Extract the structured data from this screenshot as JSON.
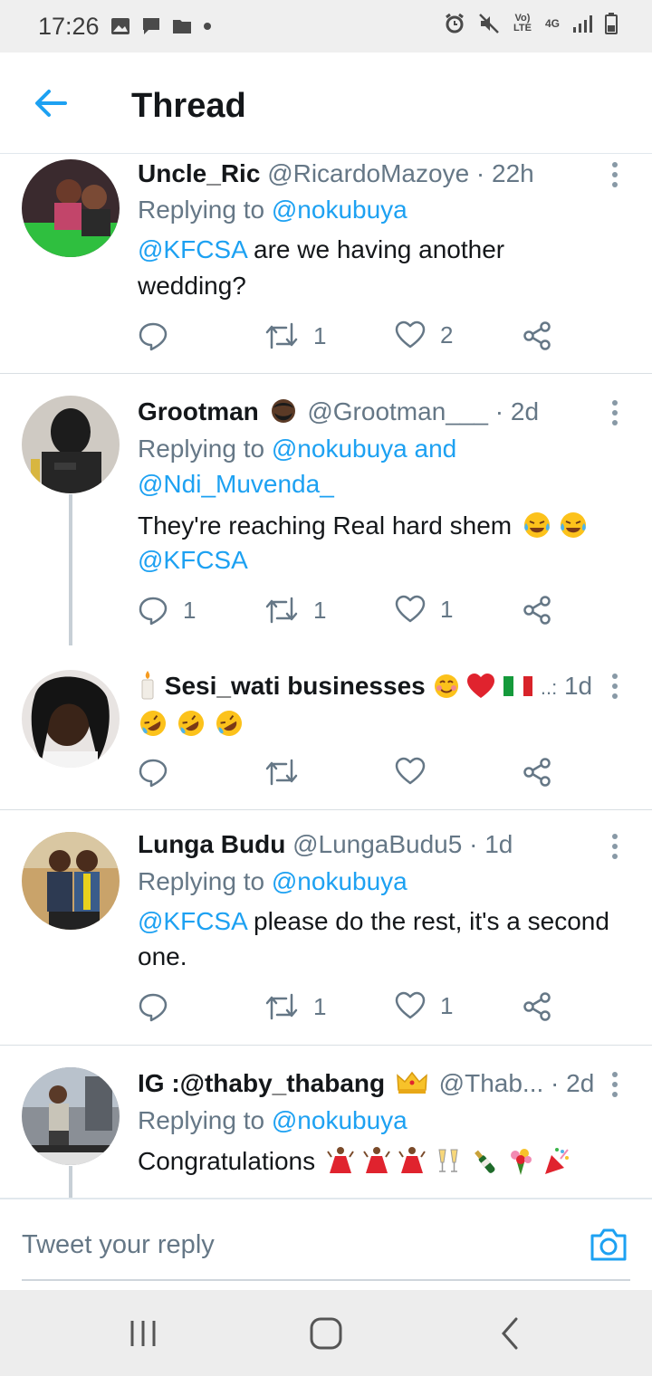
{
  "status_bar": {
    "time": "17:26",
    "volte_label": "Vo) LTE",
    "network": "4G"
  },
  "header": {
    "title": "Thread"
  },
  "tweets": [
    {
      "name": "Uncle_Ric",
      "handle": "@RicardoMazoye",
      "time": "· 22h",
      "replying_prefix": "Replying to ",
      "replying_to": "@nokubuya",
      "text_line1_mention": "@KFCSA",
      "text_line1_rest": " are we having another",
      "text_line2": "wedding?",
      "reply_count": "",
      "retweet_count": "1",
      "like_count": "2"
    },
    {
      "name": "Grootman",
      "handle": "@Grootman___",
      "time": "· 2d",
      "replying_prefix": "Replying to ",
      "replying_to": "@nokubuya and",
      "replying_to_2": "@Ndi_Muvenda_",
      "text_line1": "They're reaching Real hard shem",
      "text_line2": "@KFCSA",
      "reply_count": "1",
      "retweet_count": "1",
      "like_count": "1"
    },
    {
      "name": "Sesi_wati businesses",
      "time": "1d",
      "reply_count": "",
      "retweet_count": "",
      "like_count": ""
    },
    {
      "name": "Lunga Budu",
      "handle": "@LungaBudu5",
      "time": "· 1d",
      "replying_prefix": "Replying to ",
      "replying_to": "@nokubuya",
      "text_line1_mention": "@KFCSA",
      "text_line1_rest": " please do the rest, it's a second",
      "text_line2": "one.",
      "reply_count": "",
      "retweet_count": "1",
      "like_count": "1"
    },
    {
      "name": "IG :@thaby_thabang",
      "handle": "@Thab...",
      "time": "· 2d",
      "replying_prefix": "Replying to ",
      "replying_to": "@nokubuya",
      "text_line1": "Congratulations"
    }
  ],
  "reply_bar": {
    "placeholder": "Tweet your reply"
  },
  "colors": {
    "accent": "#1da1f2",
    "text": "#14171a",
    "muted": "#657786",
    "divider": "#d9dfe3"
  }
}
